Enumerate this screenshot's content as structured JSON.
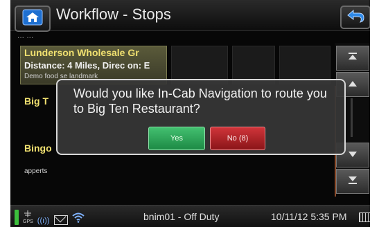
{
  "header": {
    "title": "Workflow - Stops",
    "subheader": "... ..."
  },
  "stops": [
    {
      "name": "Lunderson Wholesale Gr",
      "detail": "Distance: 4 Miles, Direc on: E",
      "note": "Demo food se landmark"
    },
    {
      "name": "Big T",
      "detail": "",
      "note": ""
    },
    {
      "name": "Bingo",
      "detail": "",
      "note": "apperts"
    }
  ],
  "dialog": {
    "message": "Would you like In-Cab Navigation to route you to Big Ten Restaurant?",
    "yes_label": "Yes",
    "no_label": "No (8)"
  },
  "status": {
    "gps_label": "GPS",
    "user": "bnim01 - Off Duty",
    "datetime": "10/11/12 5:35 PM"
  },
  "colors": {
    "yes": "#2aa055",
    "no": "#b82025",
    "accent_text": "#f0e070",
    "background": "#070707"
  },
  "icons": [
    "home-icon",
    "back-arrow-icon",
    "scroll-top-icon",
    "scroll-up-icon",
    "scroll-down-icon",
    "scroll-bottom-icon",
    "battery-icon",
    "gps-icon",
    "signal-icon",
    "mail-icon",
    "wifi-icon",
    "keyboard-icon"
  ]
}
